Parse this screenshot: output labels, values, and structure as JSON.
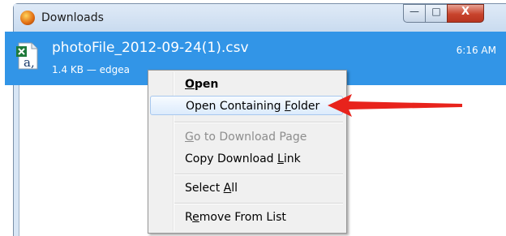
{
  "window": {
    "title": "Downloads",
    "controls": {
      "minimize": "—",
      "maximize": "□",
      "close": "X"
    }
  },
  "download": {
    "filename": "photoFile_2012-09-24(1).csv",
    "meta": "1.4 KB — edgea",
    "time": "6:16 AM"
  },
  "context_menu": {
    "items": [
      {
        "pre": "",
        "key": "O",
        "post": "pen"
      },
      {
        "pre": "Open Containing ",
        "key": "F",
        "post": "older"
      },
      {
        "pre": "",
        "key": "G",
        "post": "o to Download Page"
      },
      {
        "pre": "Copy Download ",
        "key": "L",
        "post": "ink"
      },
      {
        "pre": "Select ",
        "key": "A",
        "post": "ll"
      },
      {
        "pre": "R",
        "key": "e",
        "post": "move From List"
      }
    ]
  },
  "colors": {
    "selection": "#3295e7",
    "arrow": "#e8231c",
    "menu_bg": "#f0f0f0"
  }
}
